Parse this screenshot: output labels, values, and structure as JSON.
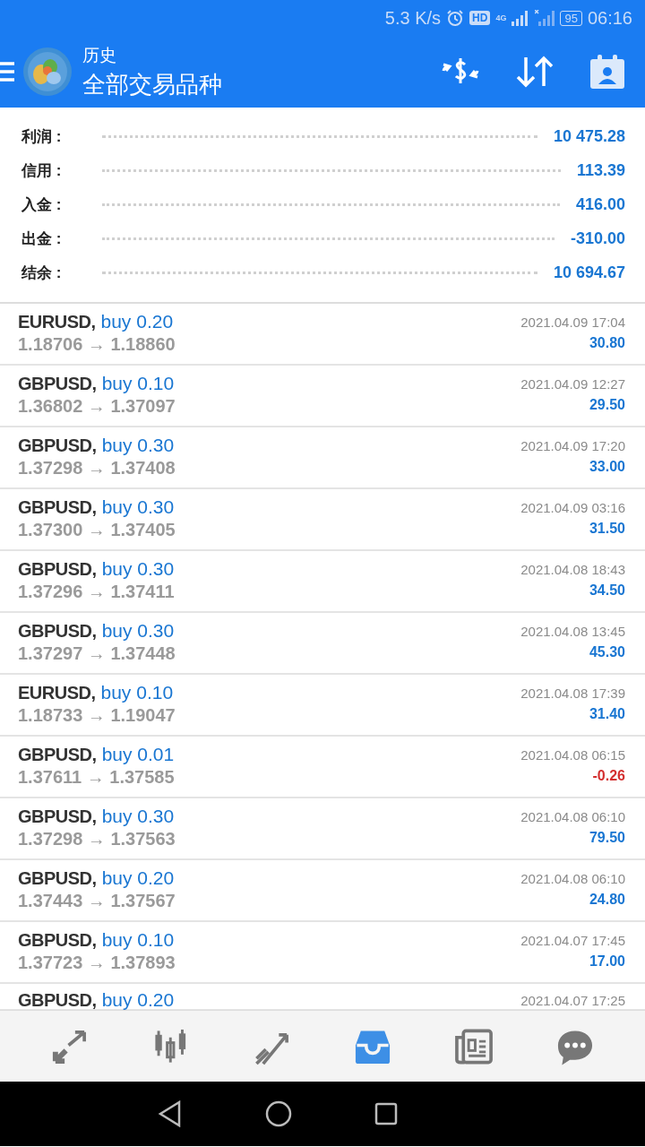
{
  "status_bar": {
    "speed": "5.3 K/s",
    "hd": "HD",
    "network": "4G",
    "battery": "95",
    "time": "06:16"
  },
  "header": {
    "title": "历史",
    "subtitle": "全部交易品种"
  },
  "summary": [
    {
      "label": "利润 :",
      "value": "10 475.28"
    },
    {
      "label": "信用 :",
      "value": "113.39"
    },
    {
      "label": "入金 :",
      "value": "416.00"
    },
    {
      "label": "出金 :",
      "value": "-310.00"
    },
    {
      "label": "结余 :",
      "value": "10 694.67"
    }
  ],
  "deals": [
    {
      "symbol": "EURUSD,",
      "side": "buy 0.20",
      "prices": "1.18706 → 1.18860",
      "time": "2021.04.09 17:04",
      "profit": "30.80",
      "color": "#1976d2"
    },
    {
      "symbol": "GBPUSD,",
      "side": "buy 0.10",
      "prices": "1.36802 → 1.37097",
      "time": "2021.04.09 12:27",
      "profit": "29.50",
      "color": "#1976d2"
    },
    {
      "symbol": "GBPUSD,",
      "side": "buy 0.30",
      "prices": "1.37298 → 1.37408",
      "time": "2021.04.09 17:20",
      "profit": "33.00",
      "color": "#1976d2"
    },
    {
      "symbol": "GBPUSD,",
      "side": "buy 0.30",
      "prices": "1.37300 → 1.37405",
      "time": "2021.04.09 03:16",
      "profit": "31.50",
      "color": "#1976d2"
    },
    {
      "symbol": "GBPUSD,",
      "side": "buy 0.30",
      "prices": "1.37296 → 1.37411",
      "time": "2021.04.08 18:43",
      "profit": "34.50",
      "color": "#1976d2"
    },
    {
      "symbol": "GBPUSD,",
      "side": "buy 0.30",
      "prices": "1.37297 → 1.37448",
      "time": "2021.04.08 13:45",
      "profit": "45.30",
      "color": "#1976d2"
    },
    {
      "symbol": "EURUSD,",
      "side": "buy 0.10",
      "prices": "1.18733 → 1.19047",
      "time": "2021.04.08 17:39",
      "profit": "31.40",
      "color": "#1976d2"
    },
    {
      "symbol": "GBPUSD,",
      "side": "buy 0.01",
      "prices": "1.37611 → 1.37585",
      "time": "2021.04.08 06:15",
      "profit": "-0.26",
      "color": "#d32f2f"
    },
    {
      "symbol": "GBPUSD,",
      "side": "buy 0.30",
      "prices": "1.37298 → 1.37563",
      "time": "2021.04.08 06:10",
      "profit": "79.50",
      "color": "#1976d2"
    },
    {
      "symbol": "GBPUSD,",
      "side": "buy 0.20",
      "prices": "1.37443 → 1.37567",
      "time": "2021.04.08 06:10",
      "profit": "24.80",
      "color": "#1976d2"
    },
    {
      "symbol": "GBPUSD,",
      "side": "buy 0.10",
      "prices": "1.37723 → 1.37893",
      "time": "2021.04.07 17:45",
      "profit": "17.00",
      "color": "#1976d2"
    },
    {
      "symbol": "GBPUSD,",
      "side": "buy 0.20",
      "time": "2021.04.07 17:25"
    }
  ],
  "bottom_tabs": [
    {
      "selected": false
    },
    {
      "selected": false
    },
    {
      "selected": false
    },
    {
      "selected": true
    },
    {
      "selected": false
    },
    {
      "selected": false
    }
  ]
}
